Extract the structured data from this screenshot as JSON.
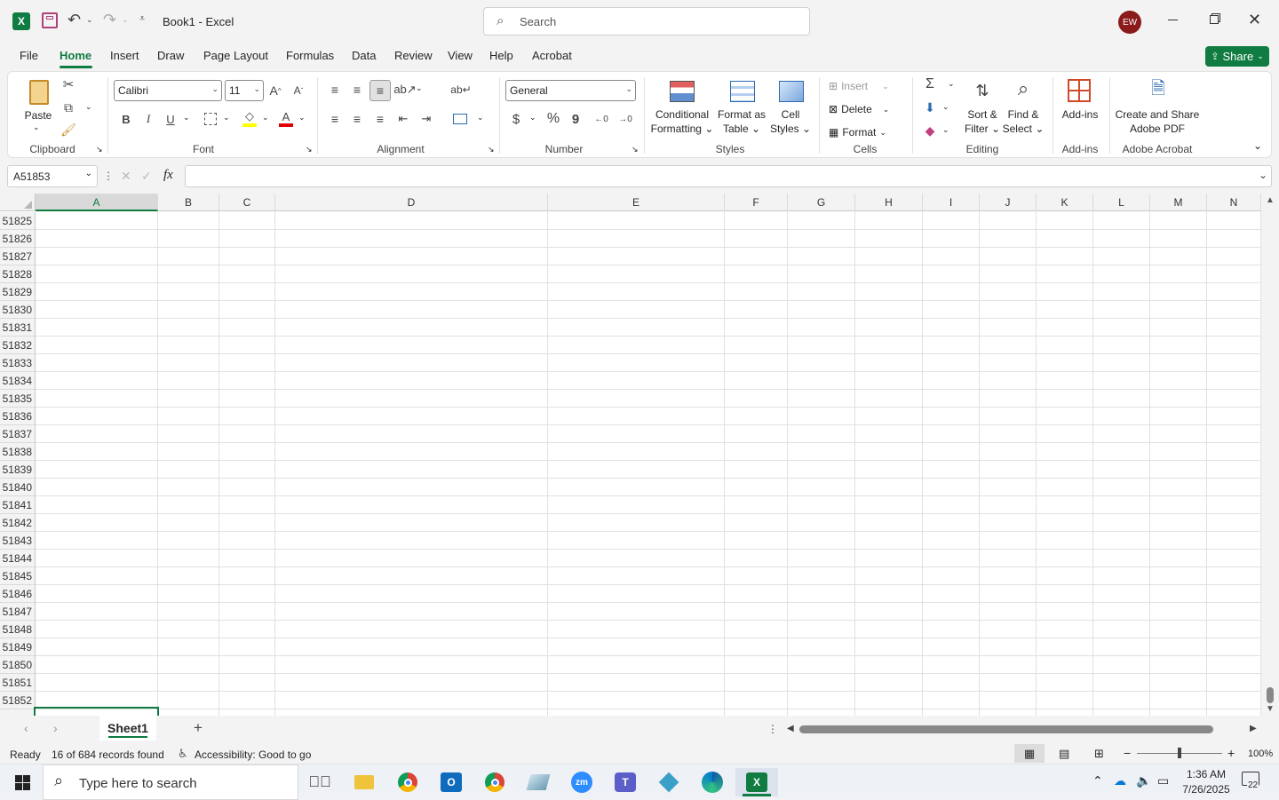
{
  "title": {
    "document": "Book1",
    "separator": "-",
    "app": "Excel",
    "search_placeholder": "Search",
    "user_initials": "EW"
  },
  "menu_tabs": [
    "File",
    "Home",
    "Insert",
    "Draw",
    "Page Layout",
    "Formulas",
    "Data",
    "Review",
    "View",
    "Help",
    "Acrobat"
  ],
  "share_label": "Share",
  "ribbon": {
    "clipboard": {
      "paste": "Paste",
      "label": "Clipboard"
    },
    "font": {
      "name": "Calibri",
      "size": "11",
      "bold": "B",
      "italic": "I",
      "underline": "U",
      "label": "Font"
    },
    "alignment": {
      "label": "Alignment"
    },
    "number": {
      "format": "General",
      "currency": "$",
      "percent": "%",
      "comma": "9",
      "label": "Number"
    },
    "styles": {
      "conditional_1": "Conditional",
      "conditional_2": "Formatting",
      "format_table_1": "Format as",
      "format_table_2": "Table",
      "cell_styles_1": "Cell",
      "cell_styles_2": "Styles",
      "label": "Styles"
    },
    "cells": {
      "insert": "Insert",
      "delete": "Delete",
      "format": "Format",
      "label": "Cells"
    },
    "editing": {
      "sort_1": "Sort &",
      "sort_2": "Filter",
      "find_1": "Find &",
      "find_2": "Select",
      "label": "Editing"
    },
    "addins": {
      "button": "Add-ins",
      "label": "Add-ins"
    },
    "acrobat": {
      "btn_1": "Create and Share",
      "btn_2": "Adobe PDF",
      "label": "Adobe Acrobat"
    }
  },
  "formula_bar": {
    "name_box": "A51853",
    "fx": "fx",
    "formula": ""
  },
  "columns": [
    "A",
    "B",
    "C",
    "D",
    "E",
    "F",
    "G",
    "H",
    "I",
    "J",
    "K",
    "L",
    "M",
    "N"
  ],
  "rows": [
    "51825",
    "51826",
    "51827",
    "51828",
    "51829",
    "51830",
    "51831",
    "51832",
    "51833",
    "51834",
    "51835",
    "51836",
    "51837",
    "51838",
    "51839",
    "51840",
    "51841",
    "51842",
    "51843",
    "51844",
    "51845",
    "51846",
    "51847",
    "51848",
    "51849",
    "51850",
    "51851",
    "51852"
  ],
  "sheets": {
    "active": "Sheet1"
  },
  "status": {
    "ready": "Ready",
    "records": "16 of 684 records found",
    "accessibility": "Accessibility: Good to go",
    "zoom": "100%"
  },
  "taskbar": {
    "search_placeholder": "Type here to search",
    "time": "1:36 AM",
    "date": "7/26/2025",
    "notifications": "22"
  },
  "colors": {
    "excel_green": "#107c41",
    "share_bg": "#107c41",
    "avatar": "#8b1a1a",
    "grid_line": "#e1e1e1",
    "selection": "#107c41"
  }
}
